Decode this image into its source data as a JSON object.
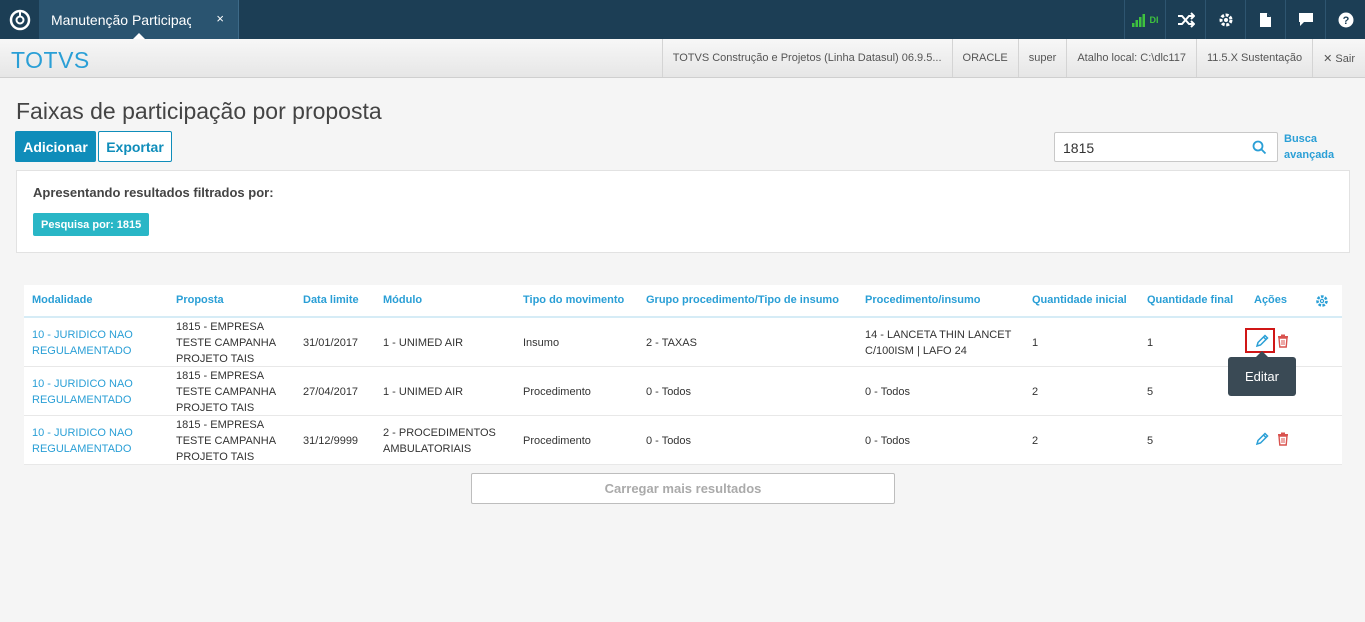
{
  "topbar": {
    "tab_label": "Manutenção Participação",
    "tab_close": "×",
    "signal_label": "DI"
  },
  "infobar": {
    "brand": "TOTVS",
    "product": "TOTVS Construção e Projetos (Linha Datasul) 06.9.5...",
    "database": "ORACLE",
    "user": "super",
    "shortcut": "Atalho local: C:\\dlc117",
    "version": "11.5.X Sustentação",
    "logout": "✕ Sair"
  },
  "page": {
    "title": "Faixas de participação por proposta",
    "add_label": "Adicionar",
    "export_label": "Exportar",
    "search_value": "1815",
    "advanced_search": "Busca avançada",
    "filter_title": "Apresentando resultados filtrados por:",
    "filter_tag": "Pesquisa por: 1815",
    "load_more": "Carregar mais resultados",
    "tooltip": "Editar"
  },
  "table": {
    "headers": {
      "modalidade": "Modalidade",
      "proposta": "Proposta",
      "data_limite": "Data limite",
      "modulo": "Módulo",
      "tipo_movimento": "Tipo do movimento",
      "grupo": "Grupo procedimento/Tipo de insumo",
      "procedimento": "Procedimento/insumo",
      "qtd_inicial": "Quantidade inicial",
      "qtd_final": "Quantidade final",
      "acoes": "Ações"
    },
    "rows": [
      {
        "modalidade": "10 - JURIDICO NAO REGULAMENTADO",
        "proposta": "1815 - EMPRESA TESTE CAMPANHA PROJETO TAIS",
        "data_limite": "31/01/2017",
        "modulo": "1 - UNIMED AIR",
        "tipo_movimento": "Insumo",
        "grupo": "2 - TAXAS",
        "procedimento": "14 - LANCETA THIN LANCET C/100ISM | LAFO 24",
        "qtd_inicial": "1",
        "qtd_final": "1"
      },
      {
        "modalidade": "10 - JURIDICO NAO REGULAMENTADO",
        "proposta": "1815 - EMPRESA TESTE CAMPANHA PROJETO TAIS",
        "data_limite": "27/04/2017",
        "modulo": "1 - UNIMED AIR",
        "tipo_movimento": "Procedimento",
        "grupo": "0 - Todos",
        "procedimento": "0 - Todos",
        "qtd_inicial": "2",
        "qtd_final": "5"
      },
      {
        "modalidade": "10 - JURIDICO NAO REGULAMENTADO",
        "proposta": "1815 - EMPRESA TESTE CAMPANHA PROJETO TAIS",
        "data_limite": "31/12/9999",
        "modulo": "2 - PROCEDIMENTOS AMBULATORIAIS",
        "tipo_movimento": "Procedimento",
        "grupo": "0 - Todos",
        "procedimento": "0 - Todos",
        "qtd_inicial": "2",
        "qtd_final": "5"
      }
    ]
  },
  "colors": {
    "topbar": "#1c3e55",
    "accent": "#2a9fd6",
    "primary_button": "#0f8dba",
    "tag": "#29b6c6",
    "delete": "#d9534f",
    "highlight": "#d01616"
  }
}
